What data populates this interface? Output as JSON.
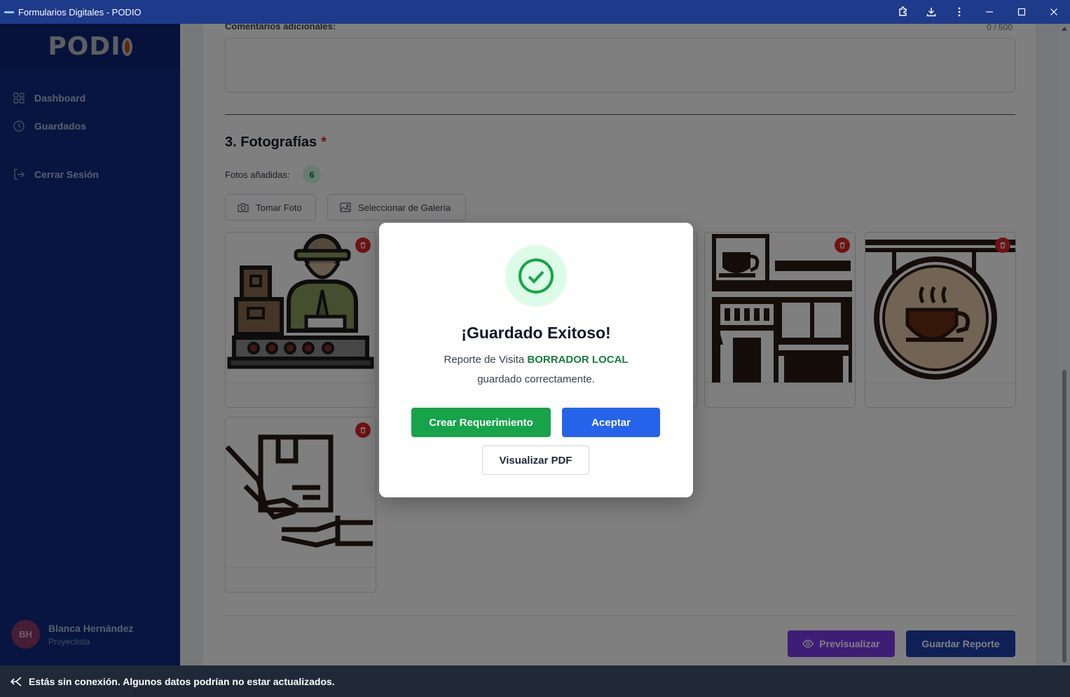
{
  "window": {
    "title": "Formularios Digitales - PODIO",
    "controls": [
      "extensions-icon",
      "download-icon",
      "more-icon",
      "minimize-icon",
      "maximize-icon",
      "close-icon"
    ]
  },
  "sidebar": {
    "logo": "PODIO",
    "items": [
      {
        "label": "Dashboard",
        "icon": "grid-icon"
      },
      {
        "label": "Guardados",
        "icon": "clock-icon"
      },
      {
        "label": "Cerrar Sesión",
        "icon": "logout-icon"
      }
    ],
    "user": {
      "initials": "BH",
      "name": "Blanca Hernández",
      "role": "Proyectista"
    }
  },
  "form": {
    "comments_label": "Comentarios adicionales:",
    "char_count": "0 / 500",
    "comments_value": "",
    "photos_section_title": "3. Fotografías",
    "required_mark": "*",
    "photos_added_label": "Fotos añadidas:",
    "photos_added_count": "6",
    "take_photo_label": "Tomar Foto",
    "gallery_label": "Seleccionar de Galería",
    "photos": [
      {
        "icon": "delivery-worker-icon"
      },
      {
        "icon": "hidden"
      },
      {
        "icon": "hidden"
      },
      {
        "icon": "cafe-storefront-icon"
      },
      {
        "icon": "coffee-sign-icon"
      },
      {
        "icon": "package-handoff-icon"
      }
    ],
    "preview_label": "Previsualizar",
    "save_label": "Guardar Reporte"
  },
  "modal": {
    "title": "¡Guardado Exitoso!",
    "msg_prefix": "Reporte de Visita",
    "msg_highlight": "BORRADOR LOCAL",
    "msg_suffix": "guardado correctamente.",
    "crear_label": "Crear Requerimiento",
    "aceptar_label": "Aceptar",
    "pdf_label": "Visualizar PDF"
  },
  "offline_banner": "Estás sin conexión. Algunos datos podrían no estar actualizados.",
  "colors": {
    "sidebar": "#0e2a80",
    "success": "#16a34a",
    "primary": "#2563eb",
    "danger": "#dc2626",
    "preview": "#7c3aed"
  }
}
